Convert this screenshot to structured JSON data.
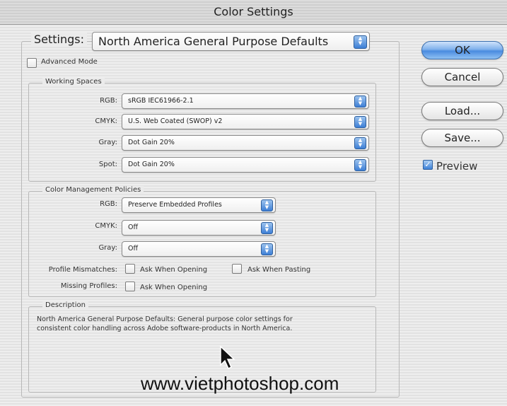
{
  "window": {
    "title": "Color Settings"
  },
  "settings": {
    "label": "Settings:",
    "value": "North America General Purpose Defaults"
  },
  "advanced_mode": {
    "label": "Advanced Mode",
    "checked": false
  },
  "working_spaces": {
    "legend": "Working Spaces",
    "rows": [
      {
        "label": "RGB:",
        "value": "sRGB IEC61966-2.1"
      },
      {
        "label": "CMYK:",
        "value": "U.S. Web Coated (SWOP) v2"
      },
      {
        "label": "Gray:",
        "value": "Dot Gain 20%"
      },
      {
        "label": "Spot:",
        "value": "Dot Gain 20%"
      }
    ]
  },
  "policies": {
    "legend": "Color Management Policies",
    "rows": [
      {
        "label": "RGB:",
        "value": "Preserve Embedded Profiles"
      },
      {
        "label": "CMYK:",
        "value": "Off"
      },
      {
        "label": "Gray:",
        "value": "Off"
      }
    ],
    "profile_mismatches": {
      "label": "Profile Mismatches:",
      "opening": "Ask When Opening",
      "pasting": "Ask When Pasting"
    },
    "missing_profiles": {
      "label": "Missing Profiles:",
      "opening": "Ask When Opening"
    }
  },
  "description": {
    "legend": "Description",
    "line1": "North America General Purpose Defaults:  General purpose color settings for",
    "line2": "consistent color handling across Adobe software-products in North America."
  },
  "buttons": {
    "ok": "OK",
    "cancel": "Cancel",
    "load": "Load...",
    "save": "Save..."
  },
  "preview": {
    "label": "Preview",
    "checked": true
  },
  "watermark": "www.vietphotoshop.com",
  "icons": {
    "popup_arrows": "up-down-arrows-icon",
    "cursor": "mouse-pointer-icon",
    "check": "checkmark-icon"
  },
  "colors": {
    "accent": "#4a8be0"
  }
}
